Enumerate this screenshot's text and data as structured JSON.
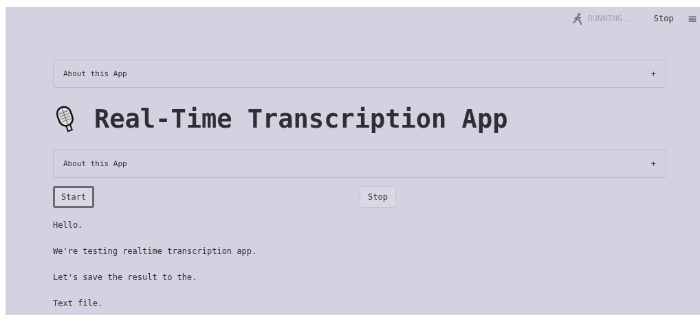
{
  "header": {
    "status": "RUNNING...",
    "stop_label": "Stop",
    "menu_icon": "≡"
  },
  "expanders": [
    {
      "label": "About this App",
      "toggle": "+",
      "expanded": false
    },
    {
      "label": "About this App",
      "toggle": "+",
      "expanded": false
    }
  ],
  "title": "Real-Time Transcription App",
  "buttons": [
    {
      "label": "Start",
      "focused": true
    },
    {
      "label": "Stop",
      "focused": false
    }
  ],
  "transcript": [
    "Hello.",
    "We're testing realtime transcription app.",
    "Let's save the result to the.",
    "Text file."
  ]
}
